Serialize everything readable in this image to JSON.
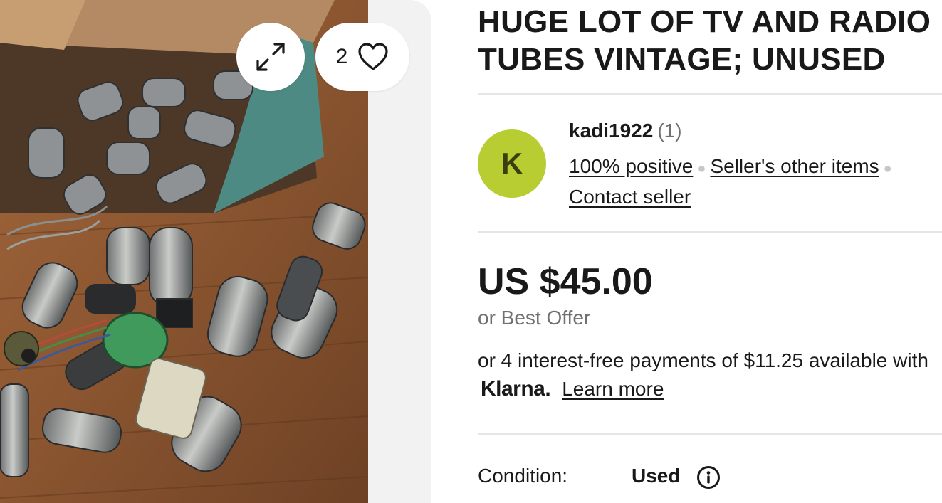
{
  "listing": {
    "title_line1": "HUGE LOT OF TV AND RADIO",
    "title_line2": "TUBES VINTAGE; UNUSED"
  },
  "gallery": {
    "photo_icon": "vacuum-tubes-photo",
    "expand_icon": "expand-icon",
    "watch_count": "2",
    "watch_icon": "heart-icon"
  },
  "seller": {
    "avatar_letter": "K",
    "avatar_color": "#b7cd31",
    "name": "kadi1922",
    "feedback_count": "(1)",
    "positive": "100% positive",
    "other_items": "Seller's other items",
    "contact": "Contact seller"
  },
  "pricing": {
    "price": "US $45.00",
    "best_offer": "or Best Offer",
    "installments": "or 4 interest-free payments of $11.25 available with",
    "klarna": "Klarna.",
    "learn_more": "Learn more"
  },
  "condition": {
    "label": "Condition:",
    "value": "Used",
    "info_icon": "info-icon"
  }
}
